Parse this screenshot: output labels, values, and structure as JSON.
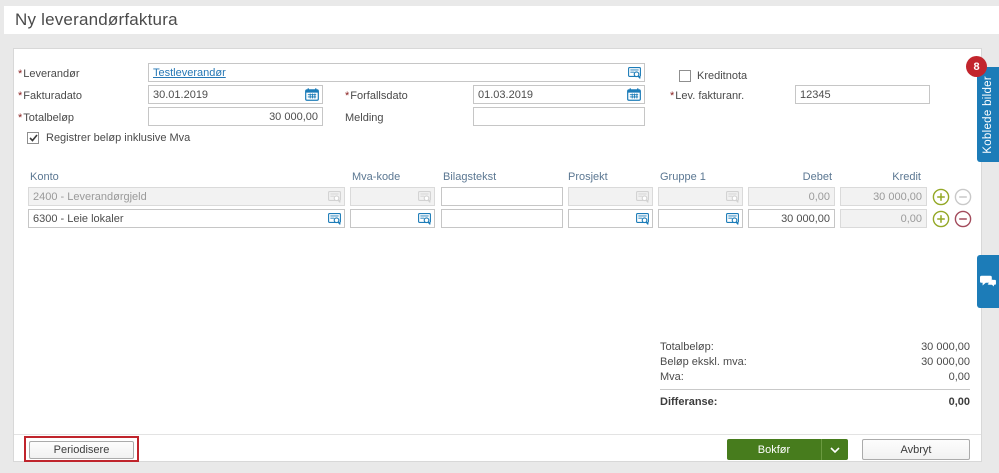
{
  "window": {
    "title": "Ny leverandørfaktura"
  },
  "form": {
    "required_marker": "*",
    "leverandor": {
      "label": "Leverandør",
      "value": "Testleverandør"
    },
    "fakturadato": {
      "label": "Fakturadato",
      "value": "30.01.2019"
    },
    "totalbelop": {
      "label": "Totalbeløp",
      "value": "30 000,00"
    },
    "forfallsdato": {
      "label": "Forfallsdato",
      "value": "01.03.2019"
    },
    "melding": {
      "label": "Melding",
      "value": ""
    },
    "kreditnota": {
      "label": "Kreditnota",
      "state": "unchecked"
    },
    "lev_fakturanr": {
      "label": "Lev. fakturanr.",
      "value": "12345"
    },
    "registrer_mva": {
      "label": "Registrer beløp inklusive Mva",
      "state": "checked"
    }
  },
  "table": {
    "headers": [
      "Konto",
      "Mva-kode",
      "Bilagstekst",
      "Prosjekt",
      "Gruppe 1",
      "Debet",
      "Kredit"
    ],
    "rows": [
      {
        "konto": {
          "value": "2400 - Leverandørgjeld",
          "state": "locked"
        },
        "mva_kode": {
          "value": "",
          "state": "locked"
        },
        "bilagstekst": {
          "value": "",
          "state": "editable"
        },
        "prosjekt": {
          "value": "",
          "state": "locked"
        },
        "gruppe_1": {
          "value": "",
          "state": "locked"
        },
        "debet": {
          "value": "0,00",
          "state": "locked"
        },
        "kredit": {
          "value": "30 000,00",
          "state": "locked"
        },
        "add": {
          "state": "editable"
        },
        "remove": {
          "state": "locked"
        }
      },
      {
        "konto": {
          "value": "6300 - Leie lokaler",
          "state": "editable"
        },
        "mva_kode": {
          "value": "",
          "state": "editable"
        },
        "bilagstekst": {
          "value": "",
          "state": "editable"
        },
        "prosjekt": {
          "value": "",
          "state": "editable"
        },
        "gruppe_1": {
          "value": "",
          "state": "editable"
        },
        "debet": {
          "value": "30 000,00",
          "state": "editable"
        },
        "kredit": {
          "value": "0,00",
          "state": "locked"
        },
        "add": {
          "state": "editable"
        },
        "remove": {
          "state": "editable"
        }
      }
    ]
  },
  "summary": {
    "rows": [
      {
        "label": "Totalbeløp:",
        "value": "30 000,00"
      },
      {
        "label": "Beløp ekskl. mva:",
        "value": "30 000,00"
      },
      {
        "label": "Mva:",
        "value": "0,00"
      }
    ],
    "differanse": {
      "label": "Differanse:",
      "value": "0,00"
    }
  },
  "footer": {
    "periodisere_label": "Periodisere",
    "bokfor_label": "Bokfør",
    "avbryt_label": "Avbryt"
  },
  "side_panel": {
    "koblede_bilder_label": "Koblede bilder",
    "badge_count": "8"
  },
  "colors": {
    "accent_blue": "#1c7cb8",
    "action_green": "#477c1d",
    "badge_red": "#c2252d",
    "annotation_red": "#c0242c",
    "plus_green": "#94a826",
    "minus_red": "#a34b5c"
  }
}
